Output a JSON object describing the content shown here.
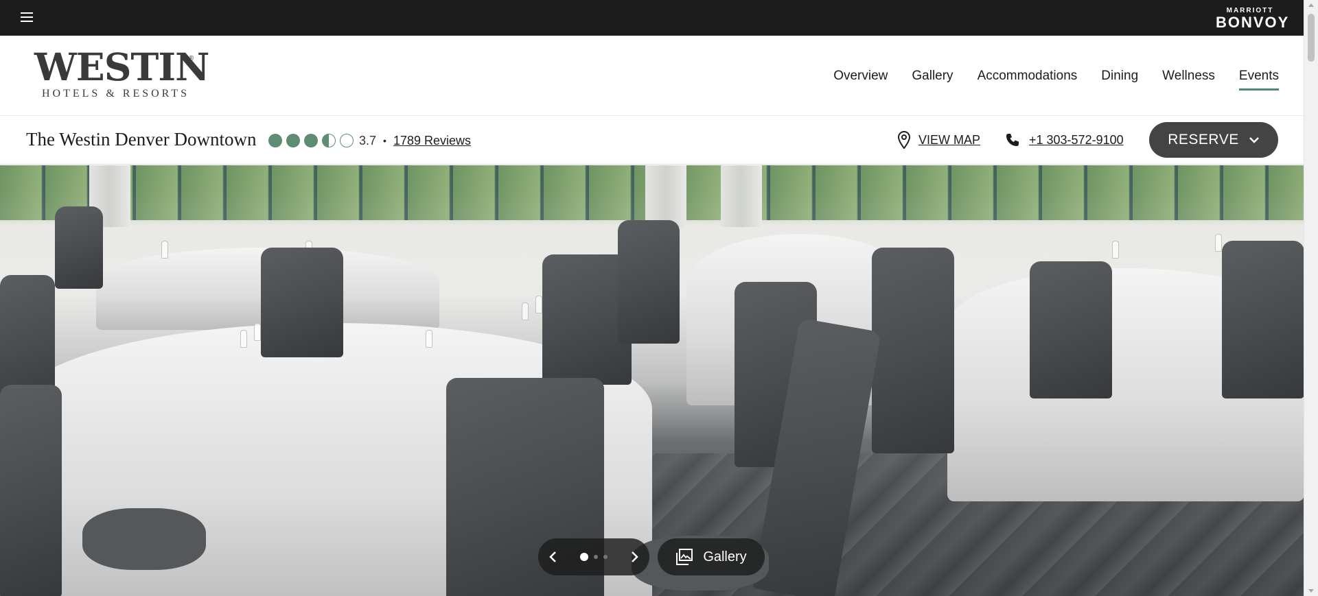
{
  "topbar": {
    "menu_icon": "hamburger-menu-icon",
    "bonvoy_small": "MARRIOTT",
    "bonvoy_big": "BONVOY"
  },
  "brand": {
    "wordmark": "WESTIN",
    "tagline": "HOTELS & RESORTS",
    "registered": "®"
  },
  "nav": {
    "items": [
      {
        "label": "Overview"
      },
      {
        "label": "Gallery"
      },
      {
        "label": "Accommodations"
      },
      {
        "label": "Dining"
      },
      {
        "label": "Wellness"
      },
      {
        "label": "Events"
      }
    ],
    "active": "Events",
    "accent_color": "#4d8a6e"
  },
  "hotel": {
    "name": "The Westin Denver Downtown",
    "rating_score": "3.7",
    "rating_value": 3.7,
    "rating_max": 5,
    "separator": "•",
    "reviews": "1789 Reviews",
    "view_map": "VIEW MAP",
    "phone": "+1 303-572-9100",
    "reserve": "RESERVE",
    "rating_color": "#5e8d73"
  },
  "hero": {
    "carousel_total": 3,
    "carousel_current": 1,
    "gallery_label": "Gallery"
  }
}
